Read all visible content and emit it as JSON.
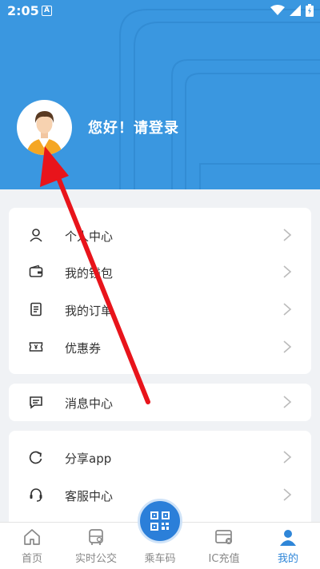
{
  "status_bar": {
    "time": "2:05",
    "notif_letter": "A"
  },
  "profile": {
    "greeting": "您好！请登录",
    "avatar_icon": "user-avatar-icon"
  },
  "menu_group_1": [
    {
      "label": "个人中心",
      "icon": "person-icon"
    },
    {
      "label": "我的钱包",
      "icon": "wallet-icon"
    },
    {
      "label": "我的订单",
      "icon": "order-icon"
    },
    {
      "label": "优惠券",
      "icon": "coupon-icon"
    }
  ],
  "menu_group_2": [
    {
      "label": "消息中心",
      "icon": "message-icon"
    }
  ],
  "menu_group_3": [
    {
      "label": "分享app",
      "icon": "share-icon"
    },
    {
      "label": "客服中心",
      "icon": "headset-icon"
    }
  ],
  "tabbar": {
    "tabs": [
      {
        "label": "首页",
        "icon": "home-icon"
      },
      {
        "label": "实时公交",
        "icon": "bus-icon"
      },
      {
        "label": "乘车码",
        "icon": "qr-code-icon"
      },
      {
        "label": "IC充值",
        "icon": "card-recharge-icon"
      },
      {
        "label": "我的",
        "icon": "profile-icon"
      }
    ],
    "active_index": 4
  },
  "colors": {
    "header_bg": "#3a97e0",
    "accent": "#2f86d8",
    "annotation_arrow": "#e8141b"
  }
}
